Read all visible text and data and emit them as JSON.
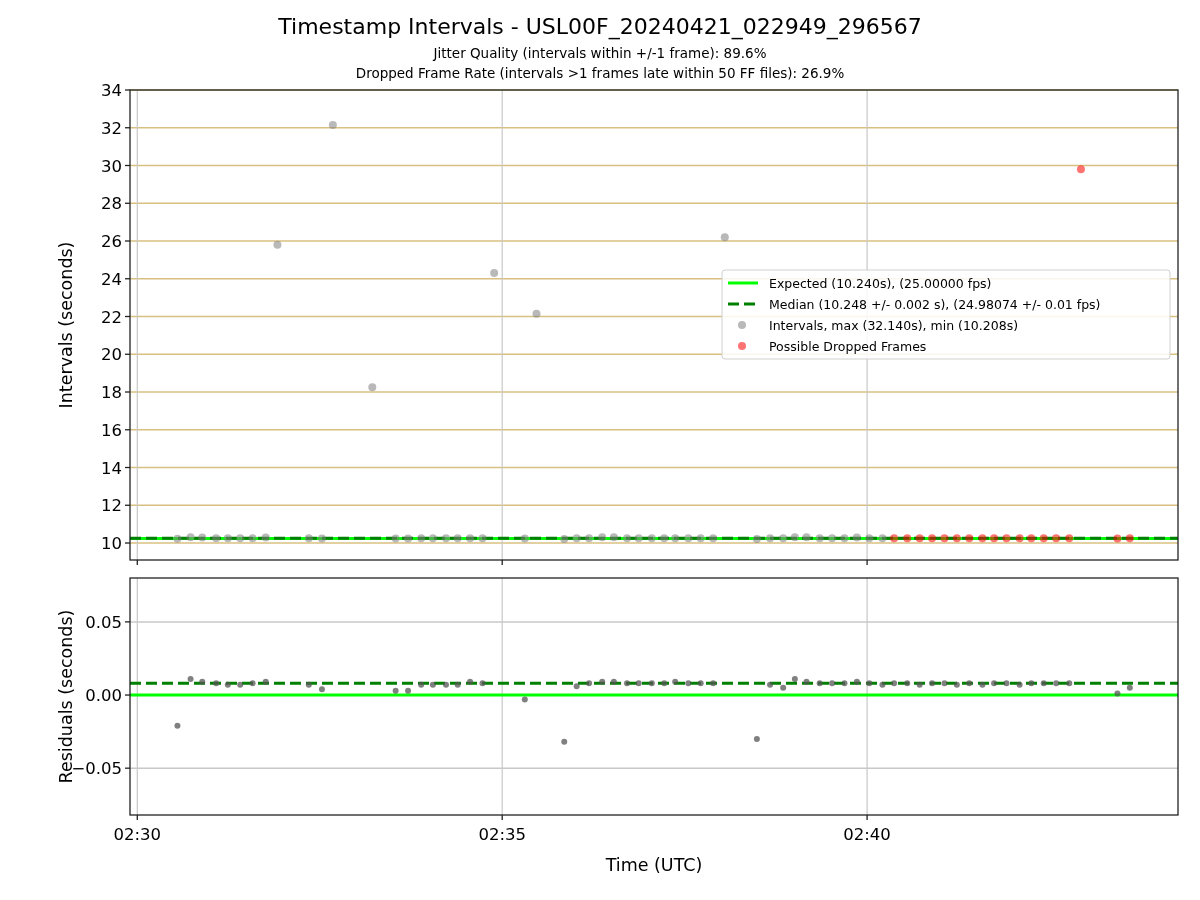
{
  "figure": {
    "title": "Timestamp Intervals - USL00F_20240421_022949_296567",
    "subtitles": [
      "Jitter Quality (intervals within +/-1 frame): 89.6%",
      "Dropped Frame Rate (intervals >1 frames late within 50 FF files): 26.9%"
    ]
  },
  "intervals_panel": {
    "chart_data": {
      "type": "scatter",
      "grid": true,
      "legend": true,
      "ylabel": "Intervals (seconds)",
      "xlim": [
        149.9,
        164.26
      ],
      "ylim": [
        9.1,
        34
      ],
      "yticks": [
        {
          "value": 10,
          "label": "10"
        },
        {
          "value": 12,
          "label": "12"
        },
        {
          "value": 14,
          "label": "14"
        },
        {
          "value": 16,
          "label": "16"
        },
        {
          "value": 18,
          "label": "18"
        },
        {
          "value": 20,
          "label": "20"
        },
        {
          "value": 22,
          "label": "22"
        },
        {
          "value": 24,
          "label": "24"
        },
        {
          "value": 26,
          "label": "26"
        },
        {
          "value": 28,
          "label": "28"
        },
        {
          "value": 30,
          "label": "30"
        },
        {
          "value": 32,
          "label": "32"
        },
        {
          "value": 34,
          "label": "34"
        }
      ],
      "series": [
        {
          "name": "Expected (10.240s), (25.00000 fps)",
          "color": "#00ff00",
          "type": "line",
          "line_style": "solid",
          "x": [
            149.9,
            164.26
          ],
          "values": [
            10.24,
            10.24
          ]
        },
        {
          "name": "Median (10.248 +/- 0.002 s), (24.98074 +/- 0.01 fps)",
          "color": "#008000",
          "type": "line",
          "line_style": "dashed",
          "x": [
            149.9,
            164.26
          ],
          "values": [
            10.25,
            10.25
          ]
        },
        {
          "name": "Intervals, max (32.140s), min (10.208s)",
          "color": "#808080",
          "type": "scatter",
          "x": [
            150.55,
            150.73,
            150.89,
            151.08,
            151.24,
            151.41,
            151.58,
            151.76,
            152.35,
            152.53,
            153.54,
            153.71,
            153.89,
            154.05,
            154.23,
            154.39,
            154.56,
            154.73,
            155.31,
            155.85,
            156.02,
            156.19,
            156.37,
            156.53,
            156.71,
            156.87,
            157.05,
            157.22,
            157.37,
            157.55,
            157.72,
            157.89,
            158.49,
            158.67,
            158.85,
            159.01,
            159.17,
            159.35,
            159.52,
            159.69,
            159.86,
            160.03,
            160.21,
            151.92,
            152.68,
            153.22,
            154.89,
            155.47,
            158.05
          ],
          "values": [
            10.22,
            10.3,
            10.29,
            10.25,
            10.25,
            10.25,
            10.25,
            10.29,
            10.25,
            10.24,
            10.24,
            10.24,
            10.25,
            10.25,
            10.25,
            10.25,
            10.25,
            10.25,
            10.24,
            10.21,
            10.25,
            10.25,
            10.3,
            10.3,
            10.25,
            10.25,
            10.25,
            10.25,
            10.25,
            10.25,
            10.25,
            10.25,
            10.21,
            10.25,
            10.25,
            10.3,
            10.3,
            10.25,
            10.25,
            10.25,
            10.29,
            10.25,
            10.25,
            25.8,
            32.14,
            18.25,
            24.3,
            22.15,
            26.2
          ]
        },
        {
          "name": "Possible Dropped Frames",
          "color": "#ff0000",
          "type": "scatter",
          "x": [
            160.37,
            160.55,
            160.72,
            160.89,
            161.06,
            161.23,
            161.4,
            161.58,
            161.74,
            161.91,
            162.09,
            162.25,
            162.42,
            162.59,
            162.77,
            163.43,
            163.6,
            162.93
          ],
          "values": [
            10.25,
            10.25,
            10.25,
            10.25,
            10.25,
            10.25,
            10.25,
            10.25,
            10.25,
            10.25,
            10.25,
            10.25,
            10.25,
            10.25,
            10.25,
            10.24,
            10.25,
            29.8
          ]
        }
      ]
    }
  },
  "residuals_panel": {
    "chart_data": {
      "type": "scatter",
      "grid": true,
      "xlabel": "Time (UTC)",
      "ylabel": "Residuals (seconds)",
      "xlim": [
        149.9,
        164.26
      ],
      "ylim": [
        -0.082,
        0.08
      ],
      "xticks": [
        {
          "value": 150,
          "label": "02:30"
        },
        {
          "value": 155,
          "label": "02:35"
        },
        {
          "value": 160,
          "label": "02:40"
        }
      ],
      "yticks": [
        {
          "value": -0.05,
          "label": "−0.05"
        },
        {
          "value": 0,
          "label": "0.00"
        },
        {
          "value": 0.05,
          "label": "0.05"
        }
      ],
      "series": [
        {
          "color": "#00ff00",
          "type": "line",
          "line_style": "solid",
          "x": [
            149.9,
            164.26
          ],
          "values": [
            0,
            0
          ]
        },
        {
          "color": "#008000",
          "type": "line",
          "line_style": "dashed",
          "x": [
            149.9,
            164.26
          ],
          "values": [
            0.008,
            0.008
          ]
        },
        {
          "color": "#555555",
          "type": "scatter",
          "x": [
            150.55,
            150.73,
            150.89,
            151.08,
            151.24,
            151.41,
            151.58,
            151.76,
            152.35,
            152.53,
            153.54,
            153.71,
            153.89,
            154.05,
            154.23,
            154.39,
            154.56,
            154.73,
            155.31,
            155.85,
            156.02,
            156.19,
            156.37,
            156.53,
            156.71,
            156.87,
            157.05,
            157.22,
            157.37,
            157.55,
            157.72,
            157.89,
            158.49,
            158.67,
            158.85,
            159.01,
            159.17,
            159.35,
            159.52,
            159.69,
            159.86,
            160.03,
            160.21,
            160.37,
            160.55,
            160.72,
            160.89,
            161.06,
            161.23,
            161.4,
            161.58,
            161.74,
            161.91,
            162.09,
            162.25,
            162.42,
            162.59,
            162.77,
            163.43,
            163.6
          ],
          "values": [
            -0.021,
            0.011,
            0.009,
            0.008,
            0.007,
            0.007,
            0.008,
            0.009,
            0.007,
            0.004,
            0.003,
            0.003,
            0.007,
            0.007,
            0.007,
            0.007,
            0.009,
            0.008,
            -0.003,
            -0.032,
            0.006,
            0.008,
            0.009,
            0.009,
            0.008,
            0.008,
            0.008,
            0.008,
            0.009,
            0.008,
            0.008,
            0.008,
            -0.03,
            0.007,
            0.005,
            0.011,
            0.009,
            0.008,
            0.008,
            0.008,
            0.009,
            0.008,
            0.007,
            0.008,
            0.008,
            0.007,
            0.008,
            0.008,
            0.007,
            0.008,
            0.007,
            0.008,
            0.008,
            0.007,
            0.008,
            0.008,
            0.008,
            0.008,
            0.001,
            0.005
          ]
        }
      ]
    }
  }
}
